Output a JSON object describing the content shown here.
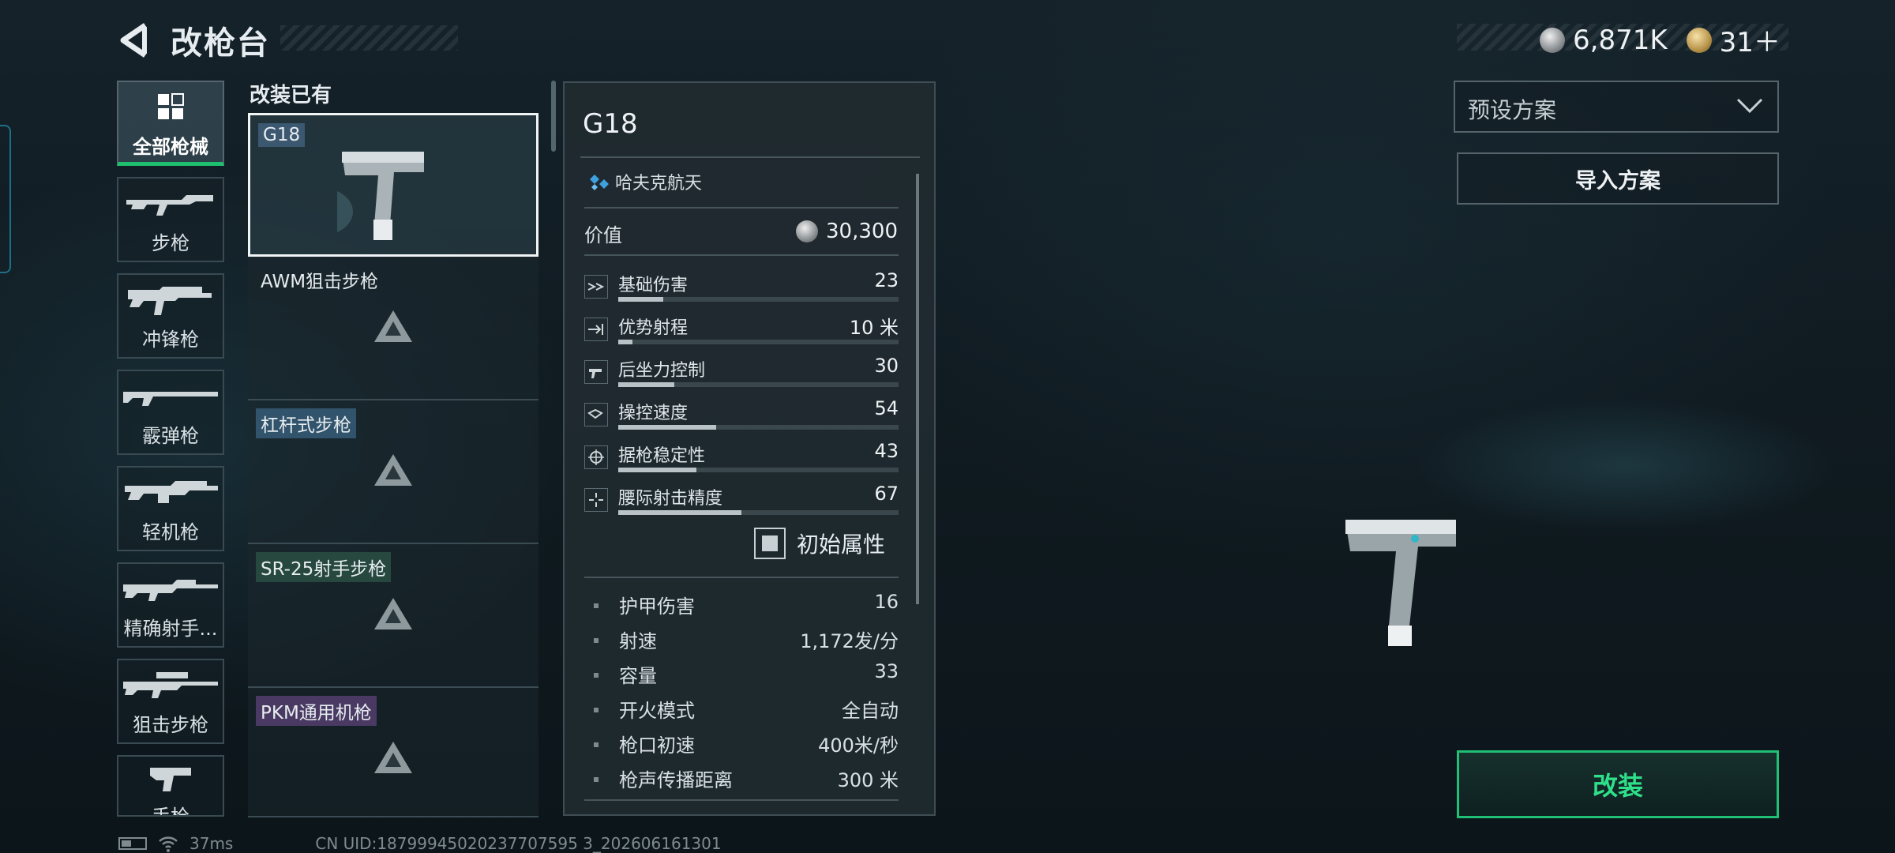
{
  "header": {
    "title": "改枪台"
  },
  "currency": {
    "silver": "6,871K",
    "gold": "31＋"
  },
  "categories": [
    {
      "label": "全部枪械",
      "icon": "grid-icon",
      "active": true
    },
    {
      "label": "步枪",
      "icon": "rifle-icon"
    },
    {
      "label": "冲锋枪",
      "icon": "smg-icon"
    },
    {
      "label": "霰弹枪",
      "icon": "shotgun-icon"
    },
    {
      "label": "轻机枪",
      "icon": "lmg-icon"
    },
    {
      "label": "精确射手...",
      "icon": "marksman-rifle-icon"
    },
    {
      "label": "狙击步枪",
      "icon": "sniper-rifle-icon"
    },
    {
      "label": "手枪",
      "icon": "pistol-icon"
    }
  ],
  "list": {
    "heading": "改装已有",
    "weapons": [
      {
        "name": "G18",
        "tag_color": "#3b5870",
        "selected": true
      },
      {
        "name": "AWM狙击步枪",
        "tag_color": ""
      },
      {
        "name": "杠杆式步枪",
        "tag_color": "#31536b"
      },
      {
        "name": "SR-25射手步枪",
        "tag_color": "#27483f"
      },
      {
        "name": "PKM通用机枪",
        "tag_color": "#4a3a63"
      }
    ]
  },
  "panel": {
    "title": "G18",
    "brand": "哈夫克航天",
    "value_label": "价值",
    "value": "30,300",
    "stats": [
      {
        "label": "基础伤害",
        "value": "23",
        "level": 0.16,
        "icon": "damage-icon"
      },
      {
        "label": "优势射程",
        "value": "10 米",
        "level": 0.05,
        "icon": "range-icon"
      },
      {
        "label": "后坐力控制",
        "value": "30",
        "level": 0.2,
        "icon": "recoil-icon"
      },
      {
        "label": "操控速度",
        "value": "54",
        "level": 0.35,
        "icon": "handling-icon"
      },
      {
        "label": "据枪稳定性",
        "value": "43",
        "level": 0.28,
        "icon": "stability-icon"
      },
      {
        "label": "腰际射击精度",
        "value": "67",
        "level": 0.44,
        "icon": "hipfire-icon"
      }
    ],
    "checkbox_label": "初始属性",
    "extra": [
      {
        "label": "护甲伤害",
        "value": "16"
      },
      {
        "label": "射速",
        "value": "1,172发/分"
      },
      {
        "label": "容量",
        "value": "33"
      },
      {
        "label": "开火模式",
        "value": "全自动"
      },
      {
        "label": "枪口初速",
        "value": "400米/秒"
      },
      {
        "label": "枪声传播距离",
        "value": "300 米"
      }
    ]
  },
  "right": {
    "preset_label": "预设方案",
    "import_label": "导入方案",
    "modify_label": "改装"
  },
  "footer": {
    "ping": "37ms",
    "uid": "CN UID:18799945020237707595 3_202606161301"
  }
}
